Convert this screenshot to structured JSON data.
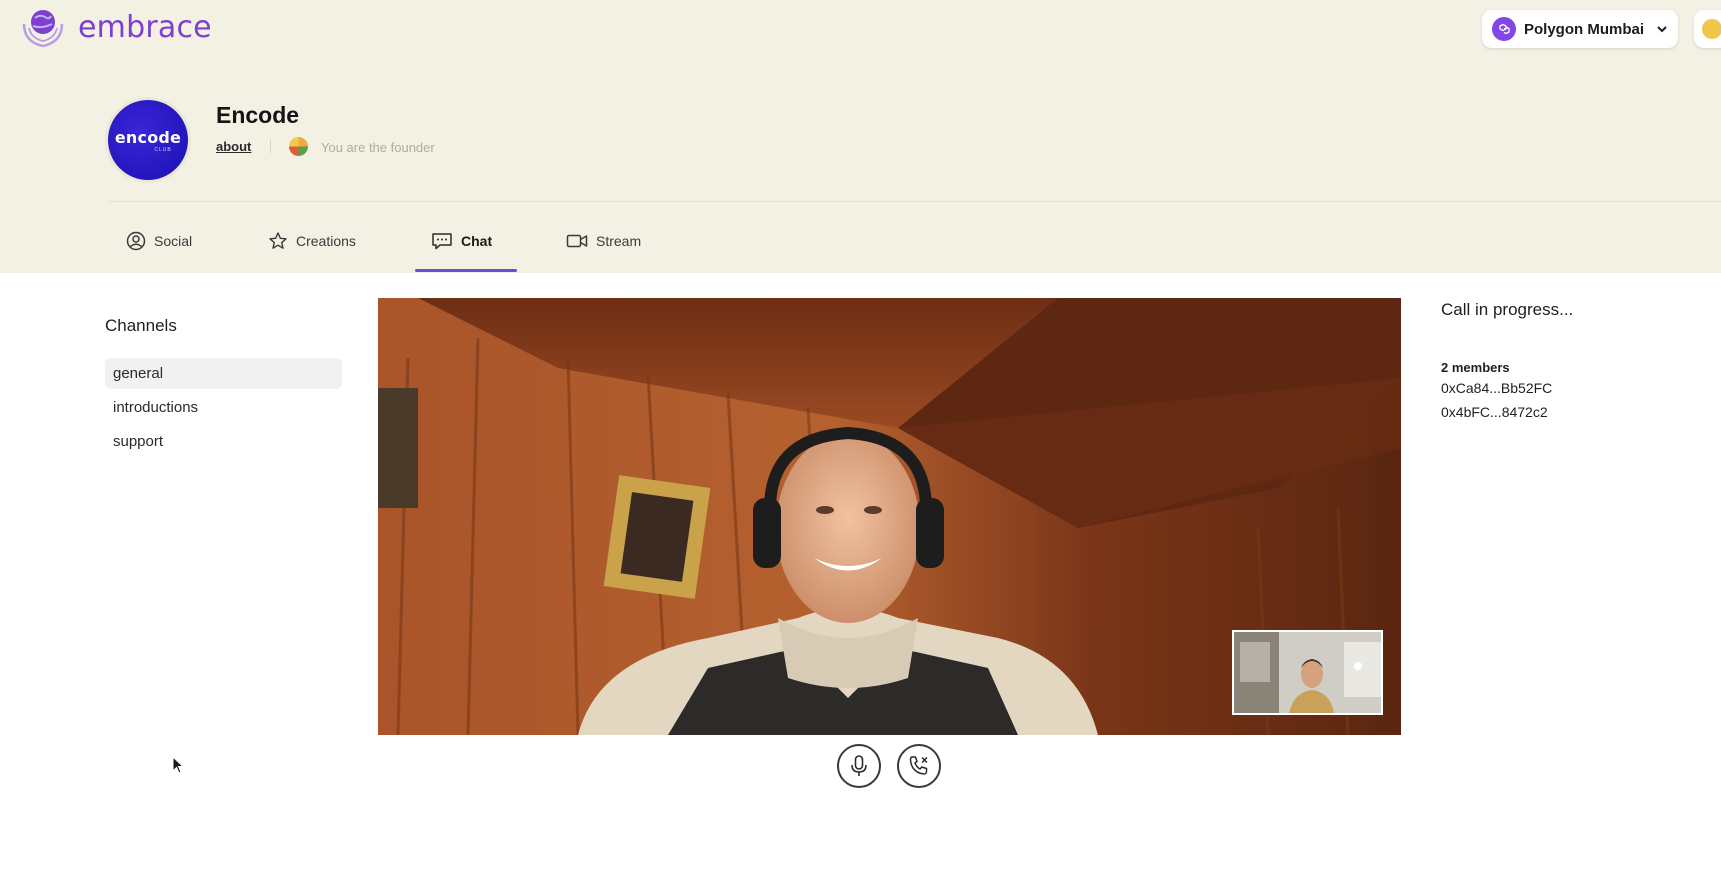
{
  "app": {
    "name": "embrace"
  },
  "network": {
    "label": "Polygon Mumbai",
    "icon": "polygon-icon",
    "accent": "#8247e5"
  },
  "community": {
    "name": "Encode",
    "avatar_text": "encode",
    "avatar_subtext": "CLUB",
    "about_label": "about",
    "role_text": "You are the founder"
  },
  "tabs": [
    {
      "label": "Social",
      "icon": "user-circle-icon"
    },
    {
      "label": "Creations",
      "icon": "star-icon"
    },
    {
      "label": "Chat",
      "icon": "chat-bubble-icon",
      "active": true
    },
    {
      "label": "Stream",
      "icon": "video-camera-icon"
    }
  ],
  "channels": {
    "title": "Channels",
    "items": [
      {
        "label": "general",
        "active": true
      },
      {
        "label": "introductions"
      },
      {
        "label": "support"
      }
    ]
  },
  "call": {
    "status": "Call in progress...",
    "members_label": "2 members",
    "members": [
      "0xCa84...Bb52FC",
      "0x4bFC...8472c2"
    ],
    "controls": [
      {
        "name": "mute",
        "icon": "microphone-icon"
      },
      {
        "name": "hang-up",
        "icon": "phone-x-icon"
      }
    ]
  },
  "colors": {
    "header_bg": "#f3f1e3",
    "brand": "#7c3fd2",
    "tab_indicator": "#6a4fd1"
  }
}
